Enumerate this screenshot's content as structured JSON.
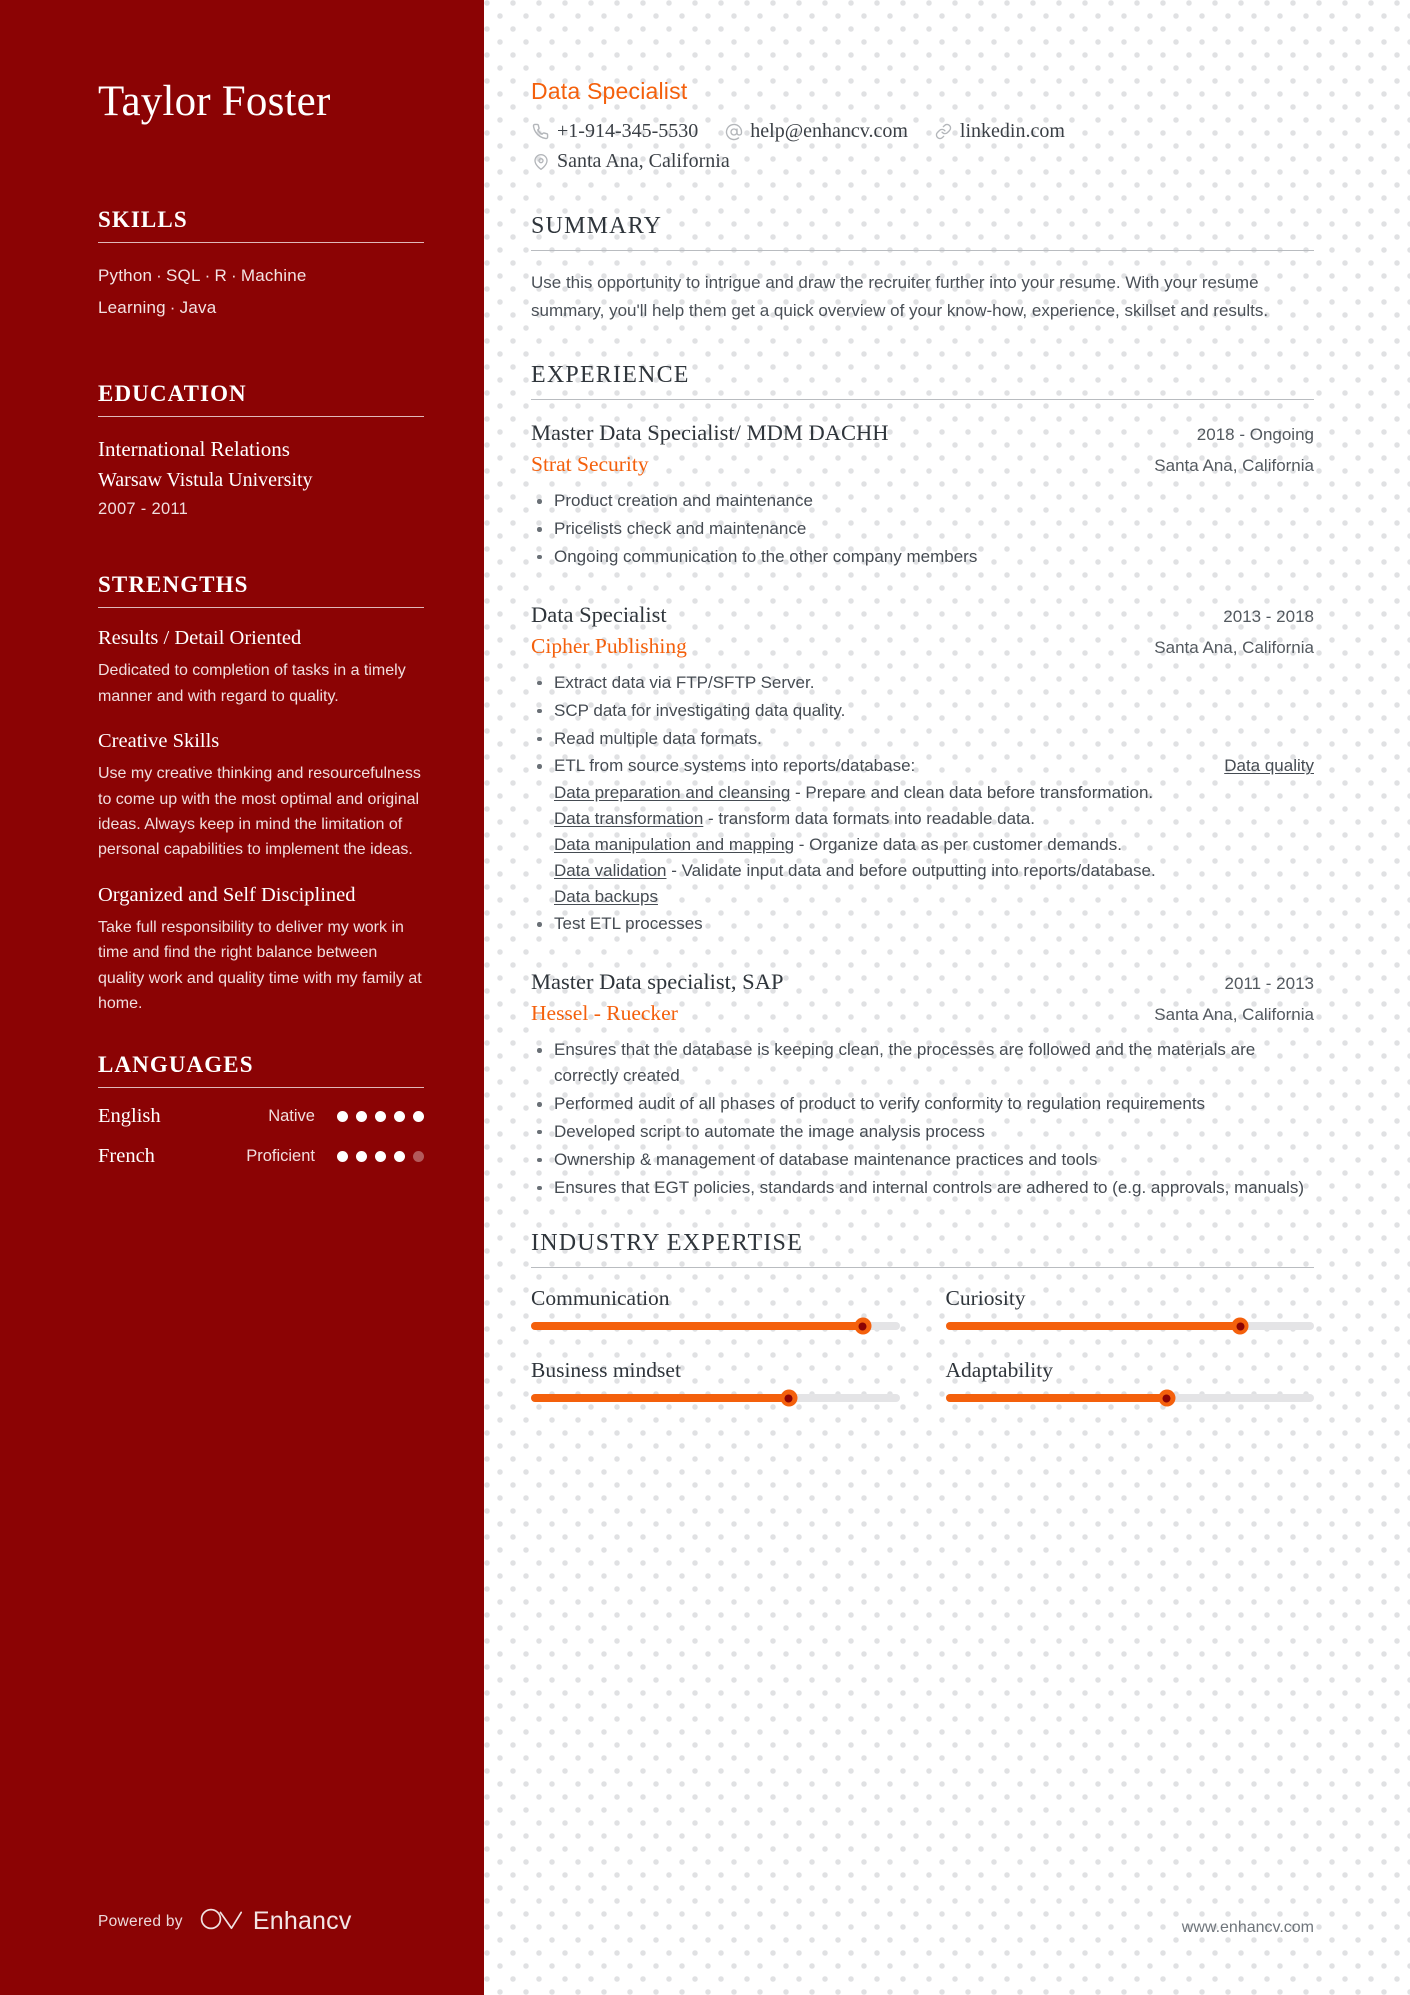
{
  "candidate": {
    "name": "Taylor Foster",
    "job_title": "Data Specialist"
  },
  "contact": {
    "phone": "+1-914-345-5530",
    "email": "help@enhancv.com",
    "link": "linkedin.com",
    "location": "Santa Ana, California",
    "icons": {
      "phone": "phone-icon",
      "email": "at-icon",
      "link": "link-icon",
      "location": "map-pin-icon"
    }
  },
  "sidebar": {
    "skills": {
      "heading": "SKILLS",
      "items": [
        "Python",
        "SQL",
        "R",
        "Machine Learning",
        "Java"
      ],
      "separator": "·"
    },
    "education": {
      "heading": "EDUCATION",
      "entries": [
        {
          "degree": "International Relations",
          "school": "Warsaw Vistula University",
          "dates": "2007 - 2011"
        }
      ]
    },
    "strengths": {
      "heading": "STRENGTHS",
      "items": [
        {
          "title": "Results / Detail Oriented",
          "description": "Dedicated to completion of tasks in a timely manner and with regard to quality."
        },
        {
          "title": "Creative Skills",
          "description": "Use my creative thinking and resourcefulness to come up with the most optimal and original ideas. Always keep in mind the limitation of personal capabilities to implement the ideas."
        },
        {
          "title": "Organized and Self Disciplined",
          "description": "Take full responsibility to deliver my work in time and find the right balance between quality work and quality time with my family at home."
        }
      ]
    },
    "languages": {
      "heading": "LANGUAGES",
      "items": [
        {
          "name": "English",
          "level": "Native",
          "rating": 5,
          "max": 5
        },
        {
          "name": "French",
          "level": "Proficient",
          "rating": 4,
          "max": 5
        }
      ]
    },
    "footer": {
      "powered_by": "Powered by",
      "brand": "Enhancv",
      "logo_icon": "enhancv-logo-icon"
    }
  },
  "main": {
    "summary": {
      "heading": "SUMMARY",
      "text": "Use this opportunity to intrigue and draw the recruiter further into your resume. With your resume summary, you'll help them get a quick overview of your know-how, experience, skillset and results."
    },
    "experience": {
      "heading": "EXPERIENCE",
      "items": [
        {
          "title": "Master Data Specialist/ MDM DACHH",
          "company": "Strat Security",
          "dates": "2018 - Ongoing",
          "location": "Santa Ana, California",
          "bullets": [
            "Product creation and maintenance",
            "Pricelists check and maintenance",
            "Ongoing communication to the other company members"
          ]
        },
        {
          "title": "Data Specialist",
          "company": "Cipher Publishing",
          "dates": "2013 - 2018",
          "location": "Santa Ana, California",
          "bullets": [
            "Extract data via FTP/SFTP Server.",
            "SCP data for investigating data quality.",
            "Read multiple data formats."
          ],
          "etl_bullet": {
            "lead": "ETL from source systems into reports/database:",
            "right_tag": "Data quality",
            "sub_lines": [
              {
                "link": "Data preparation and cleansing",
                "rest": " - Prepare and clean data before transformation."
              },
              {
                "link": "Data transformation",
                "rest": " - transform data formats into readable data."
              },
              {
                "link": "Data manipulation and mapping",
                "rest": " - Organize data as per customer            demands."
              },
              {
                "link": "Data validation",
                "rest": " - Validate input data and before outputting into reports/database."
              },
              {
                "link": "Data backups",
                "rest": ""
              }
            ]
          },
          "trailing_bullets": [
            "Test ETL processes"
          ]
        },
        {
          "title": "Master Data specialist, SAP",
          "company": "Hessel - Ruecker",
          "dates": "2011 - 2013",
          "location": "Santa Ana, California",
          "bullets": [
            "Ensures that the database is keeping clean, the processes are followed and the materials are correctly created",
            "Performed audit of all phases of product to verify conformity to regulation requirements",
            "Developed script to automate the image analysis process",
            "Ownership & management of database maintenance practices and tools",
            "Ensures that EGT policies, standards and internal controls are adhered to (e.g. approvals, manuals)"
          ]
        }
      ]
    },
    "industry_expertise": {
      "heading": "INDUSTRY EXPERTISE",
      "items": [
        {
          "label": "Communication",
          "value": 90
        },
        {
          "label": "Curiosity",
          "value": 80
        },
        {
          "label": "Business mindset",
          "value": 70
        },
        {
          "label": "Adaptability",
          "value": 60
        }
      ]
    },
    "footer_url": "www.enhancv.com"
  },
  "colors": {
    "sidebar_bg": "#8B0304",
    "accent": "#F4600C",
    "text_dark": "#2f353b"
  }
}
